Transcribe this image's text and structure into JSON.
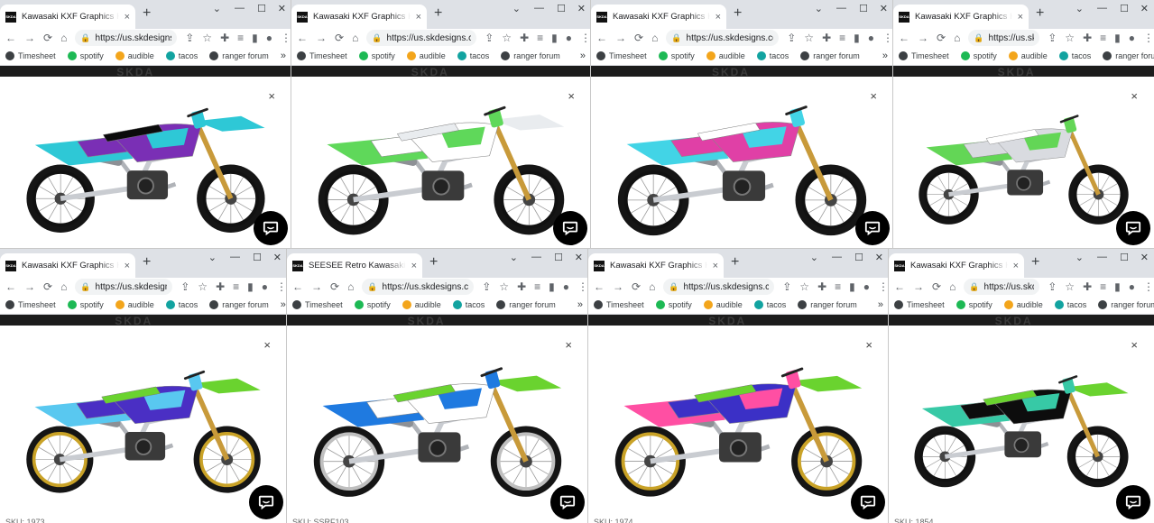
{
  "windows": [
    {
      "tab_title": "Kawasaki KXF Graphics Kit - by SKDA",
      "url": "https://us.skdesigns.com",
      "primary": "#7a2fb5",
      "secondary": "#2ec8d6",
      "accent": "#0b0b0b",
      "rim": "#111111",
      "sku": ""
    },
    {
      "tab_title": "Kawasaki KXF Graphics Kit - by SKDA",
      "url": "https://us.skdesigns.com",
      "primary": "#ffffff",
      "secondary": "#5fd85a",
      "accent": "#e9ecef",
      "rim": "#111111",
      "sku": ""
    },
    {
      "tab_title": "Kawasaki KXF Graphics Kit - by SKDA",
      "url": "https://us.skdesigns.com",
      "primary": "#e040a6",
      "secondary": "#42d4e6",
      "accent": "#ffffff",
      "rim": "#111111",
      "sku": ""
    },
    {
      "tab_title": "Kawasaki KXF Graphics Kit - by SKDA",
      "url": "https://us.skdesigns.com",
      "primary": "#d9dbe0",
      "secondary": "#63d656",
      "accent": "#ffffff",
      "rim": "#111111",
      "sku": ""
    },
    {
      "tab_title": "Kawasaki KXF Graphics Kit - by SKDA",
      "url": "https://us.skdesigns.com",
      "primary": "#4a2fc4",
      "secondary": "#59c8f0",
      "accent": "#6ad32f",
      "rim": "#c9a227",
      "sku": "SKU: 1973"
    },
    {
      "tab_title": "SEESEE Retro Kawasaki Full Graphics",
      "url": "https://us.skdesigns.com",
      "primary": "#ffffff",
      "secondary": "#1f7ae0",
      "accent": "#6ad32f",
      "rim": "#bfbfbf",
      "sku": "SKU: SSRF103"
    },
    {
      "tab_title": "Kawasaki KXF Graphics Kit - by SKDA",
      "url": "https://us.skdesigns.com",
      "primary": "#3b30c6",
      "secondary": "#ff4fa3",
      "accent": "#6ad32f",
      "rim": "#c9a227",
      "sku": "SKU: 1974"
    },
    {
      "tab_title": "Kawasaki KXF Graphics Kit - by SKDA",
      "url": "https://us.skdesigns.com",
      "primary": "#0d0d0d",
      "secondary": "#37c9a6",
      "accent": "#6ad32f",
      "rim": "#111111",
      "sku": "SKU: 1854"
    }
  ],
  "nav": {
    "back": "←",
    "forward": "→",
    "reload": "⟳",
    "home": "⌂",
    "menu": "⋮"
  },
  "bookmarks": [
    {
      "label": "Timesheet",
      "color": "#3c4043"
    },
    {
      "label": "spotify",
      "color": "#1db954"
    },
    {
      "label": "audible",
      "color": "#f3a51b"
    },
    {
      "label": "tacos",
      "color": "#12a3a0"
    },
    {
      "label": "ranger forum",
      "color": "#3c4043"
    }
  ],
  "bookmarks_more": "»",
  "favicon_text": "SKDA",
  "brand": "SKDA",
  "close_glyph": "×",
  "tab_close_glyph": "×",
  "newtab_glyph": "+",
  "lock_glyph": "🔒",
  "icons": [
    "extensions-icon",
    "reading-list-icon",
    "side-panel-icon",
    "profile-icon",
    "share-icon",
    "bookmark-star-icon",
    "chat-icon"
  ]
}
